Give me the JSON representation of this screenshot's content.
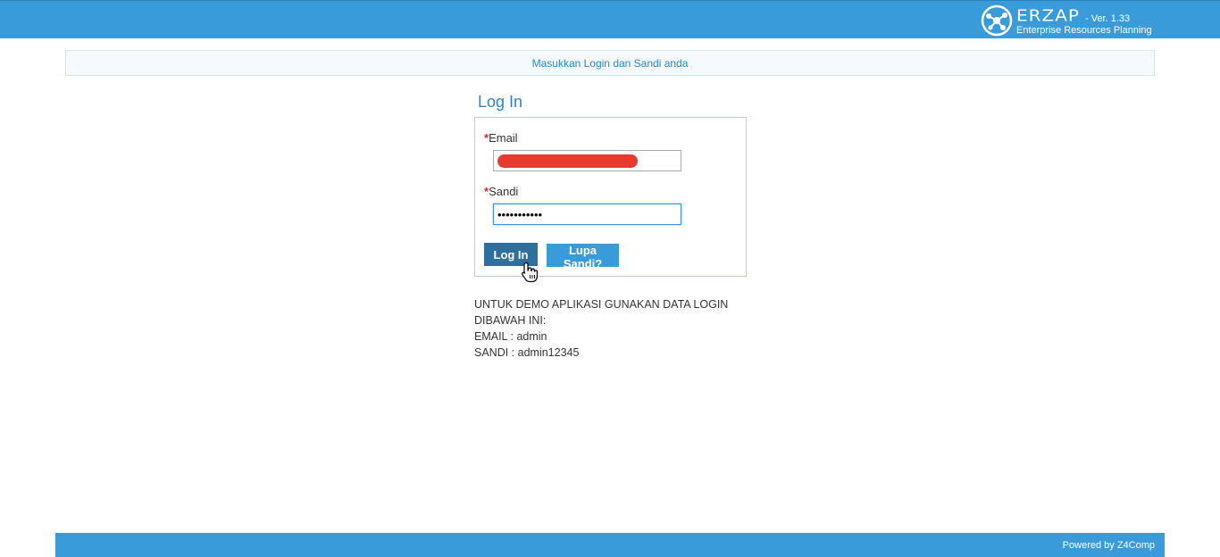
{
  "header": {
    "brand_name": "ERZAP",
    "version": "- Ver. 1.33",
    "subtitle": "Enterprise Resources Planning",
    "logo_icon": "network-circle-logo",
    "color": "#3a9bdb"
  },
  "notice": {
    "text": "Masukkan Login dan Sandi anda"
  },
  "login": {
    "title": "Log In",
    "email_label": "Email",
    "email_value": "",
    "password_label": "Sandi",
    "password_value": "•••••••••••",
    "required_mark": "*",
    "login_button": "Log In",
    "forgot_button": "Lupa Sandi?"
  },
  "demo": {
    "line1": "UNTUK DEMO APLIKASI GUNAKAN DATA LOGIN",
    "line2": "DIBAWAH INI:",
    "line3": "EMAIL : admin",
    "line4": "SANDI : admin12345"
  },
  "footer": {
    "text": "Powered by Z4Comp"
  },
  "colors": {
    "primary": "#3a9bdb",
    "dark_button": "#2e6f9e",
    "link_text": "#2a86c8",
    "required": "#d02a2a"
  }
}
